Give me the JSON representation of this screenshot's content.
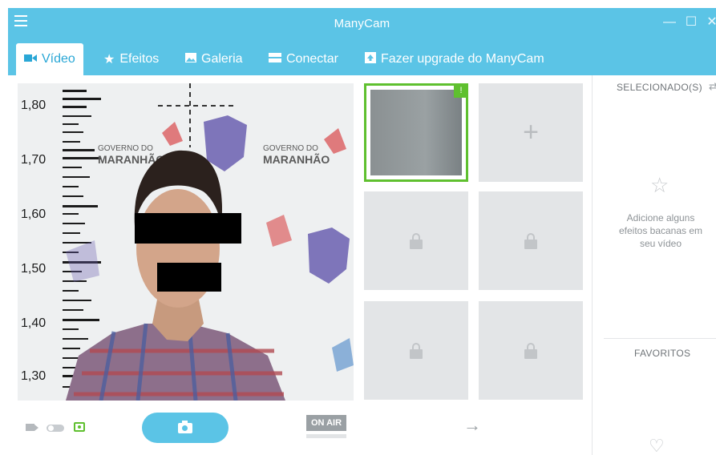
{
  "window": {
    "title": "ManyCam",
    "minimize_icon": "minimize-icon",
    "maximize_icon": "maximize-icon",
    "close_icon": "close-icon"
  },
  "tabs": [
    {
      "label": "Vídeo",
      "icon": "video-camera-icon",
      "active": true
    },
    {
      "label": "Efeitos",
      "icon": "star-icon",
      "active": false
    },
    {
      "label": "Galeria",
      "icon": "image-icon",
      "active": false
    },
    {
      "label": "Conectar",
      "icon": "connect-icon",
      "active": false
    },
    {
      "label": "Fazer upgrade do ManyCam",
      "icon": "upgrade-arrow-icon",
      "active": false
    }
  ],
  "video": {
    "height_scale": [
      "1,80",
      "1,70",
      "1,60",
      "1,50",
      "1,40",
      "1,30"
    ],
    "banner": [
      "GOVERNO DO",
      "MARANHÃO"
    ]
  },
  "sources": {
    "selected_badge": "!",
    "add_icon": "+"
  },
  "right_panel": {
    "selected_header": "SELECIONADO(S)",
    "empty_message": "Adicione alguns efeitos bacanas em seu vídeo",
    "favorites_header": "FAVORITOS"
  },
  "controls": {
    "on_air_label": "ON AIR",
    "arrow": "→"
  },
  "colors": {
    "accent": "#5bc4e6",
    "selected": "#5fc02f"
  }
}
